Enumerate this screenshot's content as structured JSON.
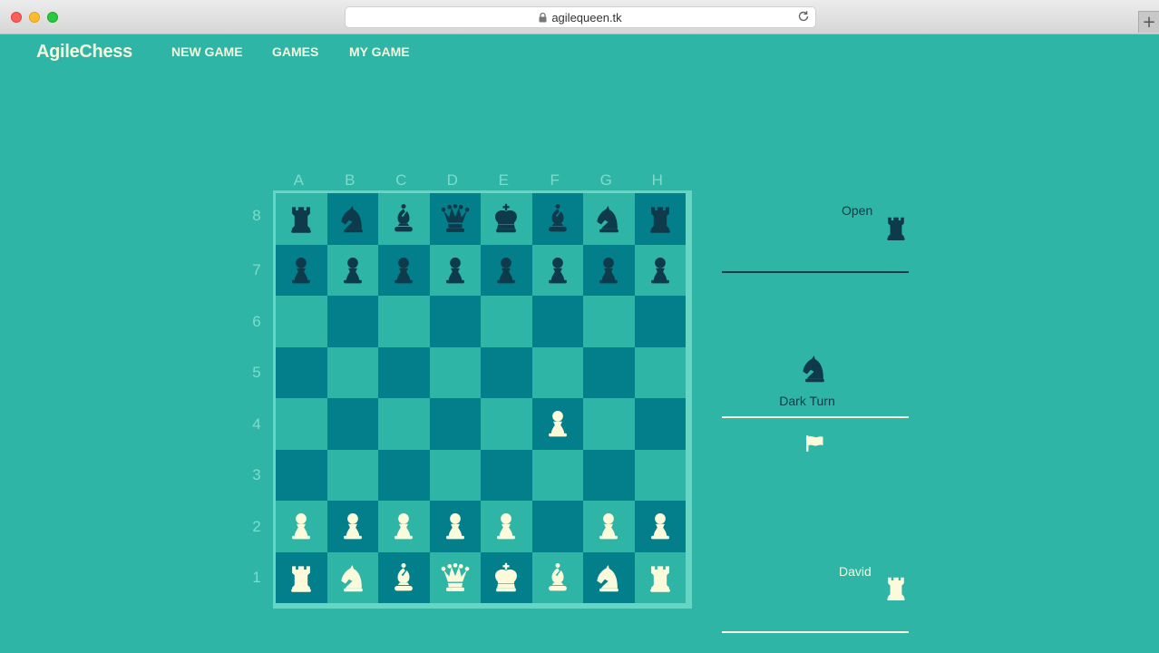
{
  "browser": {
    "url": "agilequeen.tk",
    "icons": {
      "lock": "lock-icon",
      "reload": "reload-icon",
      "new_tab": "plus-icon"
    },
    "new_tab_label": "+"
  },
  "nav": {
    "brand": "AgileChess",
    "links": [
      "NEW GAME",
      "GAMES",
      "MY GAME"
    ]
  },
  "board": {
    "files": [
      "A",
      "B",
      "C",
      "D",
      "E",
      "F",
      "G",
      "H"
    ],
    "ranks": [
      "8",
      "7",
      "6",
      "5",
      "4",
      "3",
      "2",
      "1"
    ],
    "colors": {
      "light_square": "#2fb5a6",
      "dark_square": "#037f8c",
      "border": "#65d6c5",
      "black_piece": "#0d3b4c",
      "white_piece": "#fbfbdc"
    },
    "position": [
      [
        "br",
        "bn",
        "bb",
        "bq",
        "bk",
        "bb",
        "bn",
        "br"
      ],
      [
        "bp",
        "bp",
        "bp",
        "bp",
        "bp",
        "bp",
        "bp",
        "bp"
      ],
      [
        "",
        "",
        "",
        "",
        "",
        "",
        "",
        ""
      ],
      [
        "",
        "",
        "",
        "",
        "",
        "",
        "",
        ""
      ],
      [
        "",
        "",
        "",
        "",
        "",
        "wp",
        "",
        ""
      ],
      [
        "",
        "",
        "",
        "",
        "",
        "",
        "",
        ""
      ],
      [
        "wp",
        "wp",
        "wp",
        "wp",
        "wp",
        "",
        "wp",
        "wp"
      ],
      [
        "wr",
        "wn",
        "wb",
        "wq",
        "wk",
        "wb",
        "wn",
        "wr"
      ]
    ]
  },
  "panel": {
    "opponent": {
      "name": "Open",
      "icon": "dark-rook-icon"
    },
    "turn": {
      "label": "Dark Turn",
      "icon": "dark-knight-icon"
    },
    "resign_icon": "flag-icon",
    "me": {
      "name": "David",
      "icon": "light-rook-icon"
    }
  }
}
